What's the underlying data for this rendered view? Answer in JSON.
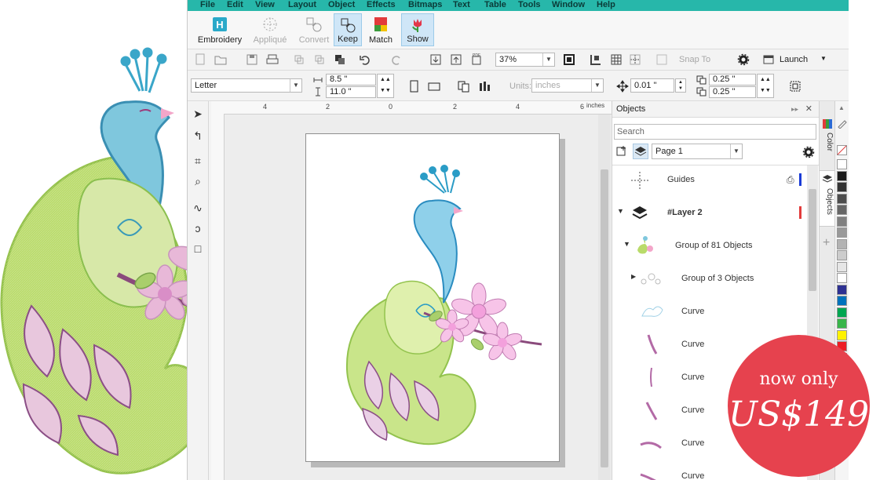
{
  "menu": [
    "File",
    "Edit",
    "View",
    "Layout",
    "Object",
    "Effects",
    "Bitmaps",
    "Text",
    "Table",
    "Tools",
    "Window",
    "Help"
  ],
  "embroidery_toolbar": [
    {
      "label": "Embroidery",
      "state": "normal"
    },
    {
      "label": "Appliqué",
      "state": "disabled"
    },
    {
      "label": "Convert",
      "state": "disabled"
    },
    {
      "label": "Keep",
      "state": "selected"
    },
    {
      "label": "Match",
      "state": "normal"
    },
    {
      "label": "Show",
      "state": "selected"
    }
  ],
  "standard_toolbar": {
    "zoom": "37%",
    "snap_to": "Snap To",
    "launch": "Launch"
  },
  "property_bar": {
    "page_size": "Letter",
    "width": "8.5 \"",
    "height": "11.0 \"",
    "units_label": "Units:",
    "units": "inches",
    "nudge": "0.01 \"",
    "dup_x": "0.25 \"",
    "dup_y": "0.25 \""
  },
  "ruler": {
    "ticks": [
      "4",
      "2",
      "0",
      "2",
      "4",
      "6"
    ],
    "unit": "inches"
  },
  "objects_docker": {
    "title": "Objects",
    "search_placeholder": "Search",
    "page": "Page 1",
    "rows": [
      {
        "label": "Guides"
      },
      {
        "label": "#Layer 2"
      },
      {
        "label": "Group of 81 Objects"
      },
      {
        "label": "Group of 3 Objects"
      },
      {
        "label": "Curve"
      },
      {
        "label": "Curve"
      },
      {
        "label": "Curve"
      },
      {
        "label": "Curve"
      },
      {
        "label": "Curve"
      },
      {
        "label": "Curve"
      }
    ]
  },
  "side_tabs": [
    "Color",
    "Objects"
  ],
  "palette": [
    "#ffffff",
    "#1a1a1a",
    "#333333",
    "#4d4d4d",
    "#666666",
    "#808080",
    "#999999",
    "#b3b3b3",
    "#cccccc",
    "#e6e6e6",
    "#ffffff",
    "#2e3192",
    "#0072bc",
    "#00a651",
    "#39b54a",
    "#fff200",
    "#ed1c24",
    "#f7941d"
  ],
  "promo": {
    "line1": "now only",
    "line2": "US$149"
  },
  "colors": {
    "menubar": "#27b7aa",
    "badge": "#e6424e",
    "selection": "#cfe6f7"
  }
}
